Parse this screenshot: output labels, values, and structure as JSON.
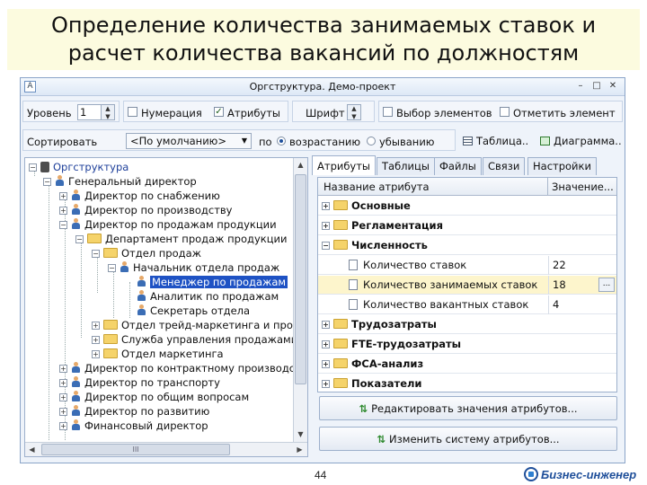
{
  "slide": {
    "title_line1": "Определение количества занимаемых ставок и",
    "title_line2": "расчет количества вакансий по должностям",
    "page_number": "44",
    "brand": "Бизнес-инженер"
  },
  "window": {
    "title": "Оргструктура. Демо-проект",
    "app_icon": "A",
    "minimize": "–",
    "maximize": "□",
    "close": "✕"
  },
  "toolbar1": {
    "level_label": "Уровень",
    "level_value": "1",
    "numbering_label": "Нумерация",
    "numbering_checked": false,
    "attributes_label": "Атрибуты",
    "attributes_checked": true,
    "font_label": "Шрифт",
    "select_elements_label": "Выбор элементов",
    "mark_element_label": "Отметить элемент"
  },
  "toolbar2": {
    "sort_label": "Сортировать",
    "sort_value": "<По умолчанию>",
    "by_label": "по",
    "asc_label": "возрастанию",
    "desc_label": "убыванию",
    "table_btn": "Таблица..",
    "diagram_btn": "Диаграмма.."
  },
  "tree": {
    "nodes": [
      {
        "label": "Оргструктура"
      },
      {
        "label": "Генеральный директор"
      },
      {
        "label": "Директор по снабжению"
      },
      {
        "label": "Директор по производству"
      },
      {
        "label": "Директор по продажам продукции"
      },
      {
        "label": "Департамент продаж продукции"
      },
      {
        "label": "Отдел продаж"
      },
      {
        "label": "Начальник отдела продаж"
      },
      {
        "label": "Менеджер по продажам"
      },
      {
        "label": "Аналитик по продажам"
      },
      {
        "label": "Секретарь отдела"
      },
      {
        "label": "Отдел трейд-маркетинга и продаж"
      },
      {
        "label": "Служба управления продажами"
      },
      {
        "label": "Отдел маркетинга"
      },
      {
        "label": "Директор по контрактному производству"
      },
      {
        "label": "Директор по транспорту"
      },
      {
        "label": "Директор по общим вопросам"
      },
      {
        "label": "Директор по развитию"
      },
      {
        "label": "Финансовый директор"
      }
    ],
    "hscroll_grip": "III"
  },
  "tabs": [
    {
      "label": "Атрибуты"
    },
    {
      "label": "Таблицы"
    },
    {
      "label": "Файлы"
    },
    {
      "label": "Связи"
    },
    {
      "label": "Настройки"
    }
  ],
  "grid": {
    "col_name": "Название атрибута",
    "col_value": "Значение...",
    "rows": [
      {
        "label": "Основные",
        "value": ""
      },
      {
        "label": "Регламентация",
        "value": ""
      },
      {
        "label": "Численность",
        "value": ""
      },
      {
        "label": "Количество ставок",
        "value": "22"
      },
      {
        "label": "Количество занимаемых ставок",
        "value": "18"
      },
      {
        "label": "Количество вакантных ставок",
        "value": "4"
      },
      {
        "label": "Трудозатраты",
        "value": ""
      },
      {
        "label": "FTE-трудозатраты",
        "value": ""
      },
      {
        "label": "ФСА-анализ",
        "value": ""
      },
      {
        "label": "Показатели",
        "value": ""
      }
    ],
    "ellipsis": "..."
  },
  "actions": {
    "edit_values": "Редактировать значения атрибутов...",
    "change_system": "Изменить систему атрибутов..."
  }
}
